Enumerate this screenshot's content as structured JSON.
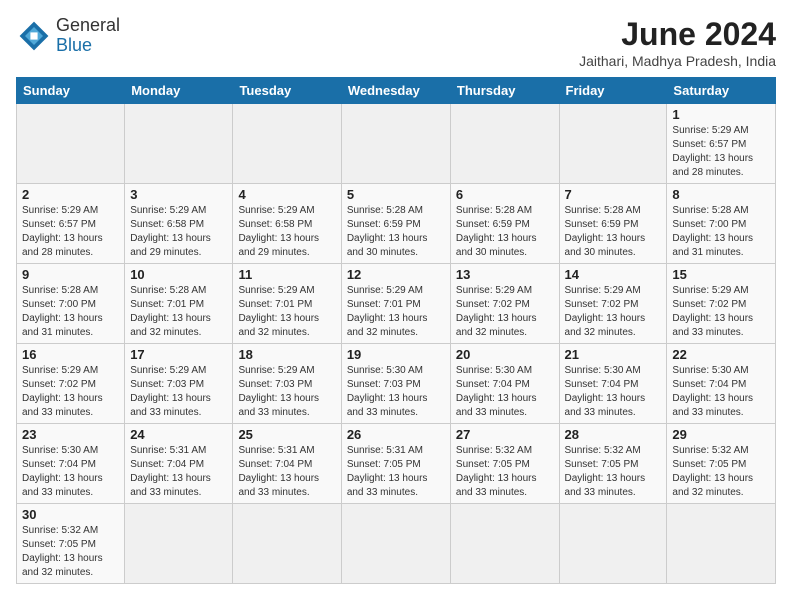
{
  "header": {
    "logo_line1": "General",
    "logo_line2": "Blue",
    "title": "June 2024",
    "subtitle": "Jaithari, Madhya Pradesh, India"
  },
  "weekdays": [
    "Sunday",
    "Monday",
    "Tuesday",
    "Wednesday",
    "Thursday",
    "Friday",
    "Saturday"
  ],
  "weeks": [
    [
      {
        "day": "",
        "info": ""
      },
      {
        "day": "",
        "info": ""
      },
      {
        "day": "",
        "info": ""
      },
      {
        "day": "",
        "info": ""
      },
      {
        "day": "",
        "info": ""
      },
      {
        "day": "",
        "info": ""
      },
      {
        "day": "1",
        "info": "Sunrise: 5:29 AM\nSunset: 6:57 PM\nDaylight: 13 hours and 28 minutes."
      }
    ],
    [
      {
        "day": "2",
        "info": "Sunrise: 5:29 AM\nSunset: 6:57 PM\nDaylight: 13 hours and 28 minutes."
      },
      {
        "day": "3",
        "info": "Sunrise: 5:29 AM\nSunset: 6:58 PM\nDaylight: 13 hours and 29 minutes."
      },
      {
        "day": "4",
        "info": "Sunrise: 5:29 AM\nSunset: 6:58 PM\nDaylight: 13 hours and 29 minutes."
      },
      {
        "day": "5",
        "info": "Sunrise: 5:28 AM\nSunset: 6:59 PM\nDaylight: 13 hours and 30 minutes."
      },
      {
        "day": "6",
        "info": "Sunrise: 5:28 AM\nSunset: 6:59 PM\nDaylight: 13 hours and 30 minutes."
      },
      {
        "day": "7",
        "info": "Sunrise: 5:28 AM\nSunset: 6:59 PM\nDaylight: 13 hours and 30 minutes."
      },
      {
        "day": "8",
        "info": "Sunrise: 5:28 AM\nSunset: 7:00 PM\nDaylight: 13 hours and 31 minutes."
      }
    ],
    [
      {
        "day": "9",
        "info": "Sunrise: 5:28 AM\nSunset: 7:00 PM\nDaylight: 13 hours and 31 minutes."
      },
      {
        "day": "10",
        "info": "Sunrise: 5:28 AM\nSunset: 7:01 PM\nDaylight: 13 hours and 32 minutes."
      },
      {
        "day": "11",
        "info": "Sunrise: 5:29 AM\nSunset: 7:01 PM\nDaylight: 13 hours and 32 minutes."
      },
      {
        "day": "12",
        "info": "Sunrise: 5:29 AM\nSunset: 7:01 PM\nDaylight: 13 hours and 32 minutes."
      },
      {
        "day": "13",
        "info": "Sunrise: 5:29 AM\nSunset: 7:02 PM\nDaylight: 13 hours and 32 minutes."
      },
      {
        "day": "14",
        "info": "Sunrise: 5:29 AM\nSunset: 7:02 PM\nDaylight: 13 hours and 32 minutes."
      },
      {
        "day": "15",
        "info": "Sunrise: 5:29 AM\nSunset: 7:02 PM\nDaylight: 13 hours and 33 minutes."
      }
    ],
    [
      {
        "day": "16",
        "info": "Sunrise: 5:29 AM\nSunset: 7:02 PM\nDaylight: 13 hours and 33 minutes."
      },
      {
        "day": "17",
        "info": "Sunrise: 5:29 AM\nSunset: 7:03 PM\nDaylight: 13 hours and 33 minutes."
      },
      {
        "day": "18",
        "info": "Sunrise: 5:29 AM\nSunset: 7:03 PM\nDaylight: 13 hours and 33 minutes."
      },
      {
        "day": "19",
        "info": "Sunrise: 5:30 AM\nSunset: 7:03 PM\nDaylight: 13 hours and 33 minutes."
      },
      {
        "day": "20",
        "info": "Sunrise: 5:30 AM\nSunset: 7:04 PM\nDaylight: 13 hours and 33 minutes."
      },
      {
        "day": "21",
        "info": "Sunrise: 5:30 AM\nSunset: 7:04 PM\nDaylight: 13 hours and 33 minutes."
      },
      {
        "day": "22",
        "info": "Sunrise: 5:30 AM\nSunset: 7:04 PM\nDaylight: 13 hours and 33 minutes."
      }
    ],
    [
      {
        "day": "23",
        "info": "Sunrise: 5:30 AM\nSunset: 7:04 PM\nDaylight: 13 hours and 33 minutes."
      },
      {
        "day": "24",
        "info": "Sunrise: 5:31 AM\nSunset: 7:04 PM\nDaylight: 13 hours and 33 minutes."
      },
      {
        "day": "25",
        "info": "Sunrise: 5:31 AM\nSunset: 7:04 PM\nDaylight: 13 hours and 33 minutes."
      },
      {
        "day": "26",
        "info": "Sunrise: 5:31 AM\nSunset: 7:05 PM\nDaylight: 13 hours and 33 minutes."
      },
      {
        "day": "27",
        "info": "Sunrise: 5:32 AM\nSunset: 7:05 PM\nDaylight: 13 hours and 33 minutes."
      },
      {
        "day": "28",
        "info": "Sunrise: 5:32 AM\nSunset: 7:05 PM\nDaylight: 13 hours and 33 minutes."
      },
      {
        "day": "29",
        "info": "Sunrise: 5:32 AM\nSunset: 7:05 PM\nDaylight: 13 hours and 32 minutes."
      }
    ],
    [
      {
        "day": "30",
        "info": "Sunrise: 5:32 AM\nSunset: 7:05 PM\nDaylight: 13 hours and 32 minutes."
      },
      {
        "day": "",
        "info": ""
      },
      {
        "day": "",
        "info": ""
      },
      {
        "day": "",
        "info": ""
      },
      {
        "day": "",
        "info": ""
      },
      {
        "day": "",
        "info": ""
      },
      {
        "day": "",
        "info": ""
      }
    ]
  ]
}
